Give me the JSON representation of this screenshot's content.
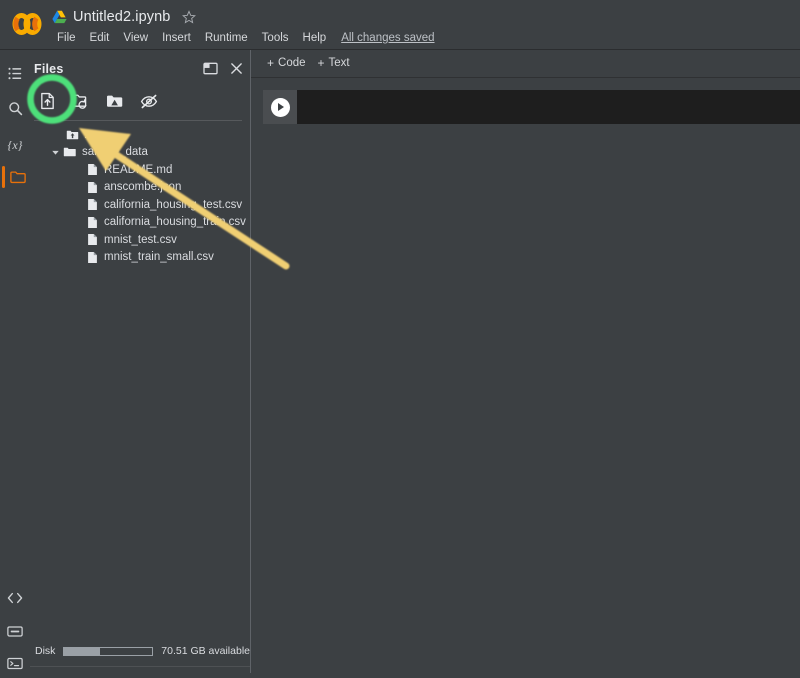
{
  "window": {
    "app_name": "Colab",
    "logo_icon": "colab-logo-icon"
  },
  "titlebar": {
    "drive_icon": "google-drive-icon",
    "notebook_name": "Untitled2.ipynb",
    "star_icon": "star-outline-icon"
  },
  "menubar": {
    "items": [
      {
        "label": "File"
      },
      {
        "label": "Edit"
      },
      {
        "label": "View"
      },
      {
        "label": "Insert"
      },
      {
        "label": "Runtime"
      },
      {
        "label": "Tools"
      },
      {
        "label": "Help"
      }
    ],
    "status": "All changes saved"
  },
  "rail": {
    "items": [
      {
        "name": "table-of-contents",
        "icon": "list-icon",
        "selected": false
      },
      {
        "name": "find-and-replace",
        "icon": "search-icon",
        "selected": false
      },
      {
        "name": "variables",
        "icon": "variables-icon",
        "label": "{x}",
        "selected": false
      },
      {
        "name": "files",
        "icon": "folder-icon",
        "selected": true
      }
    ],
    "bottom_items": [
      {
        "name": "code-snippets",
        "icon": "code-brackets-icon"
      },
      {
        "name": "command-palette",
        "icon": "command-palette-icon"
      },
      {
        "name": "terminal",
        "icon": "terminal-icon"
      }
    ]
  },
  "files_panel": {
    "title": "Files",
    "header_actions": [
      {
        "name": "open-in-new-pane",
        "icon": "new-window-icon"
      },
      {
        "name": "close-panel",
        "icon": "close-icon"
      }
    ],
    "toolbar": [
      {
        "name": "upload-to-session-storage",
        "icon": "upload-file-icon",
        "highlighted": true
      },
      {
        "name": "refresh-folder",
        "icon": "refresh-folder-icon",
        "highlighted": false
      },
      {
        "name": "mount-drive",
        "icon": "mount-drive-icon",
        "highlighted": false
      },
      {
        "name": "toggle-hidden-files",
        "icon": "eye-off-icon",
        "highlighted": false
      }
    ],
    "tree": [
      {
        "label": "..",
        "type": "parent",
        "icon": "folder-up-icon",
        "indent": 0,
        "caret": "none"
      },
      {
        "label": "sample_data",
        "type": "folder",
        "icon": "folder-icon",
        "indent": 0,
        "caret": "expanded"
      },
      {
        "label": "README.md",
        "type": "file",
        "icon": "file-icon",
        "indent": 1,
        "caret": "none"
      },
      {
        "label": "anscombe.json",
        "type": "file",
        "icon": "file-icon",
        "indent": 1,
        "caret": "none"
      },
      {
        "label": "california_housing_test.csv",
        "type": "file",
        "icon": "file-icon",
        "indent": 1,
        "caret": "none"
      },
      {
        "label": "california_housing_train.csv",
        "type": "file",
        "icon": "file-icon",
        "indent": 1,
        "caret": "none"
      },
      {
        "label": "mnist_test.csv",
        "type": "file",
        "icon": "file-icon",
        "indent": 1,
        "caret": "none"
      },
      {
        "label": "mnist_train_small.csv",
        "type": "file",
        "icon": "file-icon",
        "indent": 1,
        "caret": "none"
      }
    ],
    "disk": {
      "label": "Disk",
      "available_text": "70.51 GB available",
      "used_percent": 40
    }
  },
  "notebook": {
    "toolbar": {
      "add_code": "+ Code",
      "add_code_plus": "+",
      "add_code_label": "Code",
      "add_text_plus": "+",
      "add_text_label": "Text"
    },
    "cells": [
      {
        "type": "code",
        "run_icon": "play-icon",
        "source": ""
      }
    ]
  },
  "annotations": {
    "highlight_circle": {
      "name": "upload-button-highlight",
      "color": "#4ee07a",
      "target": "upload-to-session-storage"
    },
    "arrow": {
      "name": "pointer-arrow",
      "color": "#f0cf73",
      "points_to": "upload-to-session-storage"
    }
  },
  "colors": {
    "app_background": "#3c4043",
    "cell_background": "#1e1e1e",
    "accent_orange": "#e8710a",
    "highlight_green": "#4ee07a",
    "arrow_gold": "#f0cf73",
    "text_primary": "#e8eaed",
    "text_secondary": "#bdc1c6"
  }
}
